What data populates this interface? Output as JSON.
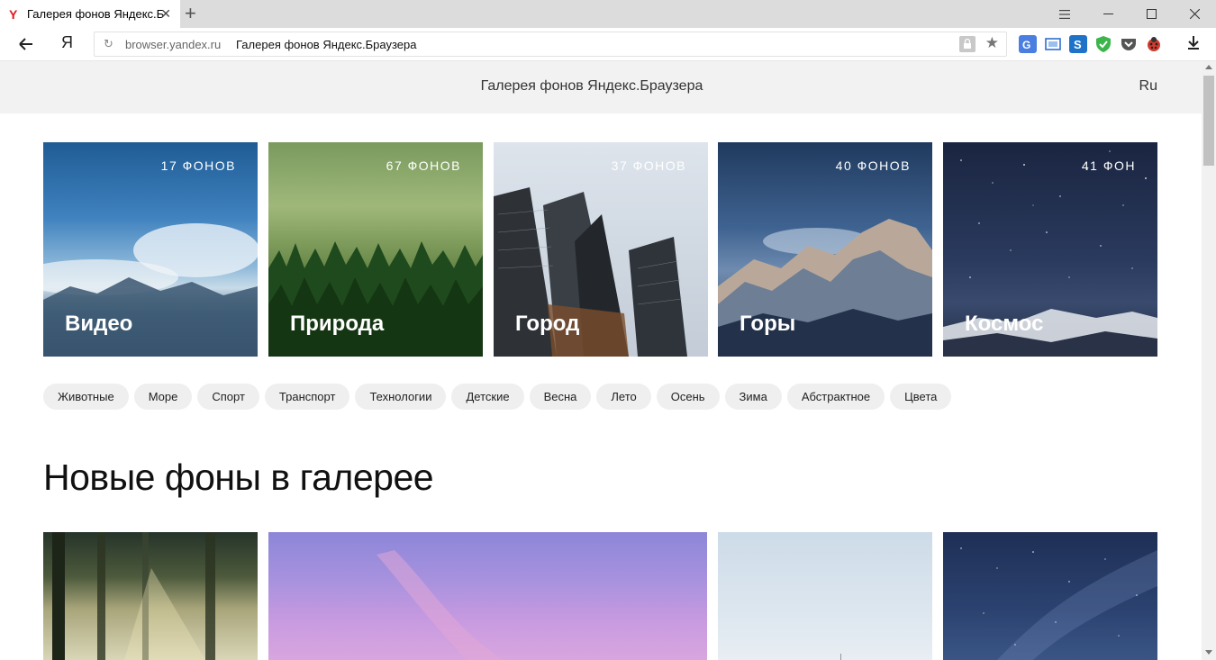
{
  "tab": {
    "title": "Галерея фонов Яндекс.Браузера",
    "favicon": "Y",
    "close": "✕"
  },
  "new_tab_label": "+",
  "window": {
    "minimize": "—",
    "maximize": "☐",
    "close": "✕",
    "menu": "☰"
  },
  "toolbar": {
    "back_icon": "arrow-left-icon",
    "yandex_label": "Я",
    "url_domain": "browser.yandex.ru",
    "url_title": "Галерея фонов Яндекс.Браузера",
    "reload": "↻",
    "star": "★",
    "download": "⤓"
  },
  "page": {
    "header_title": "Галерея фонов Яндекс.Браузера",
    "lang": "Ru",
    "section_title": "Новые фоны в галерее"
  },
  "categories": [
    {
      "name": "Видео",
      "count": "17 ФОНОВ"
    },
    {
      "name": "Природа",
      "count": "67 ФОНОВ"
    },
    {
      "name": "Город",
      "count": "37 ФОНОВ"
    },
    {
      "name": "Горы",
      "count": "40 ФОНОВ"
    },
    {
      "name": "Космос",
      "count": "41 ФОН"
    }
  ],
  "chips": [
    "Животные",
    "Море",
    "Спорт",
    "Транспорт",
    "Технологии",
    "Детские",
    "Весна",
    "Лето",
    "Осень",
    "Зима",
    "Абстрактное",
    "Цвета"
  ]
}
